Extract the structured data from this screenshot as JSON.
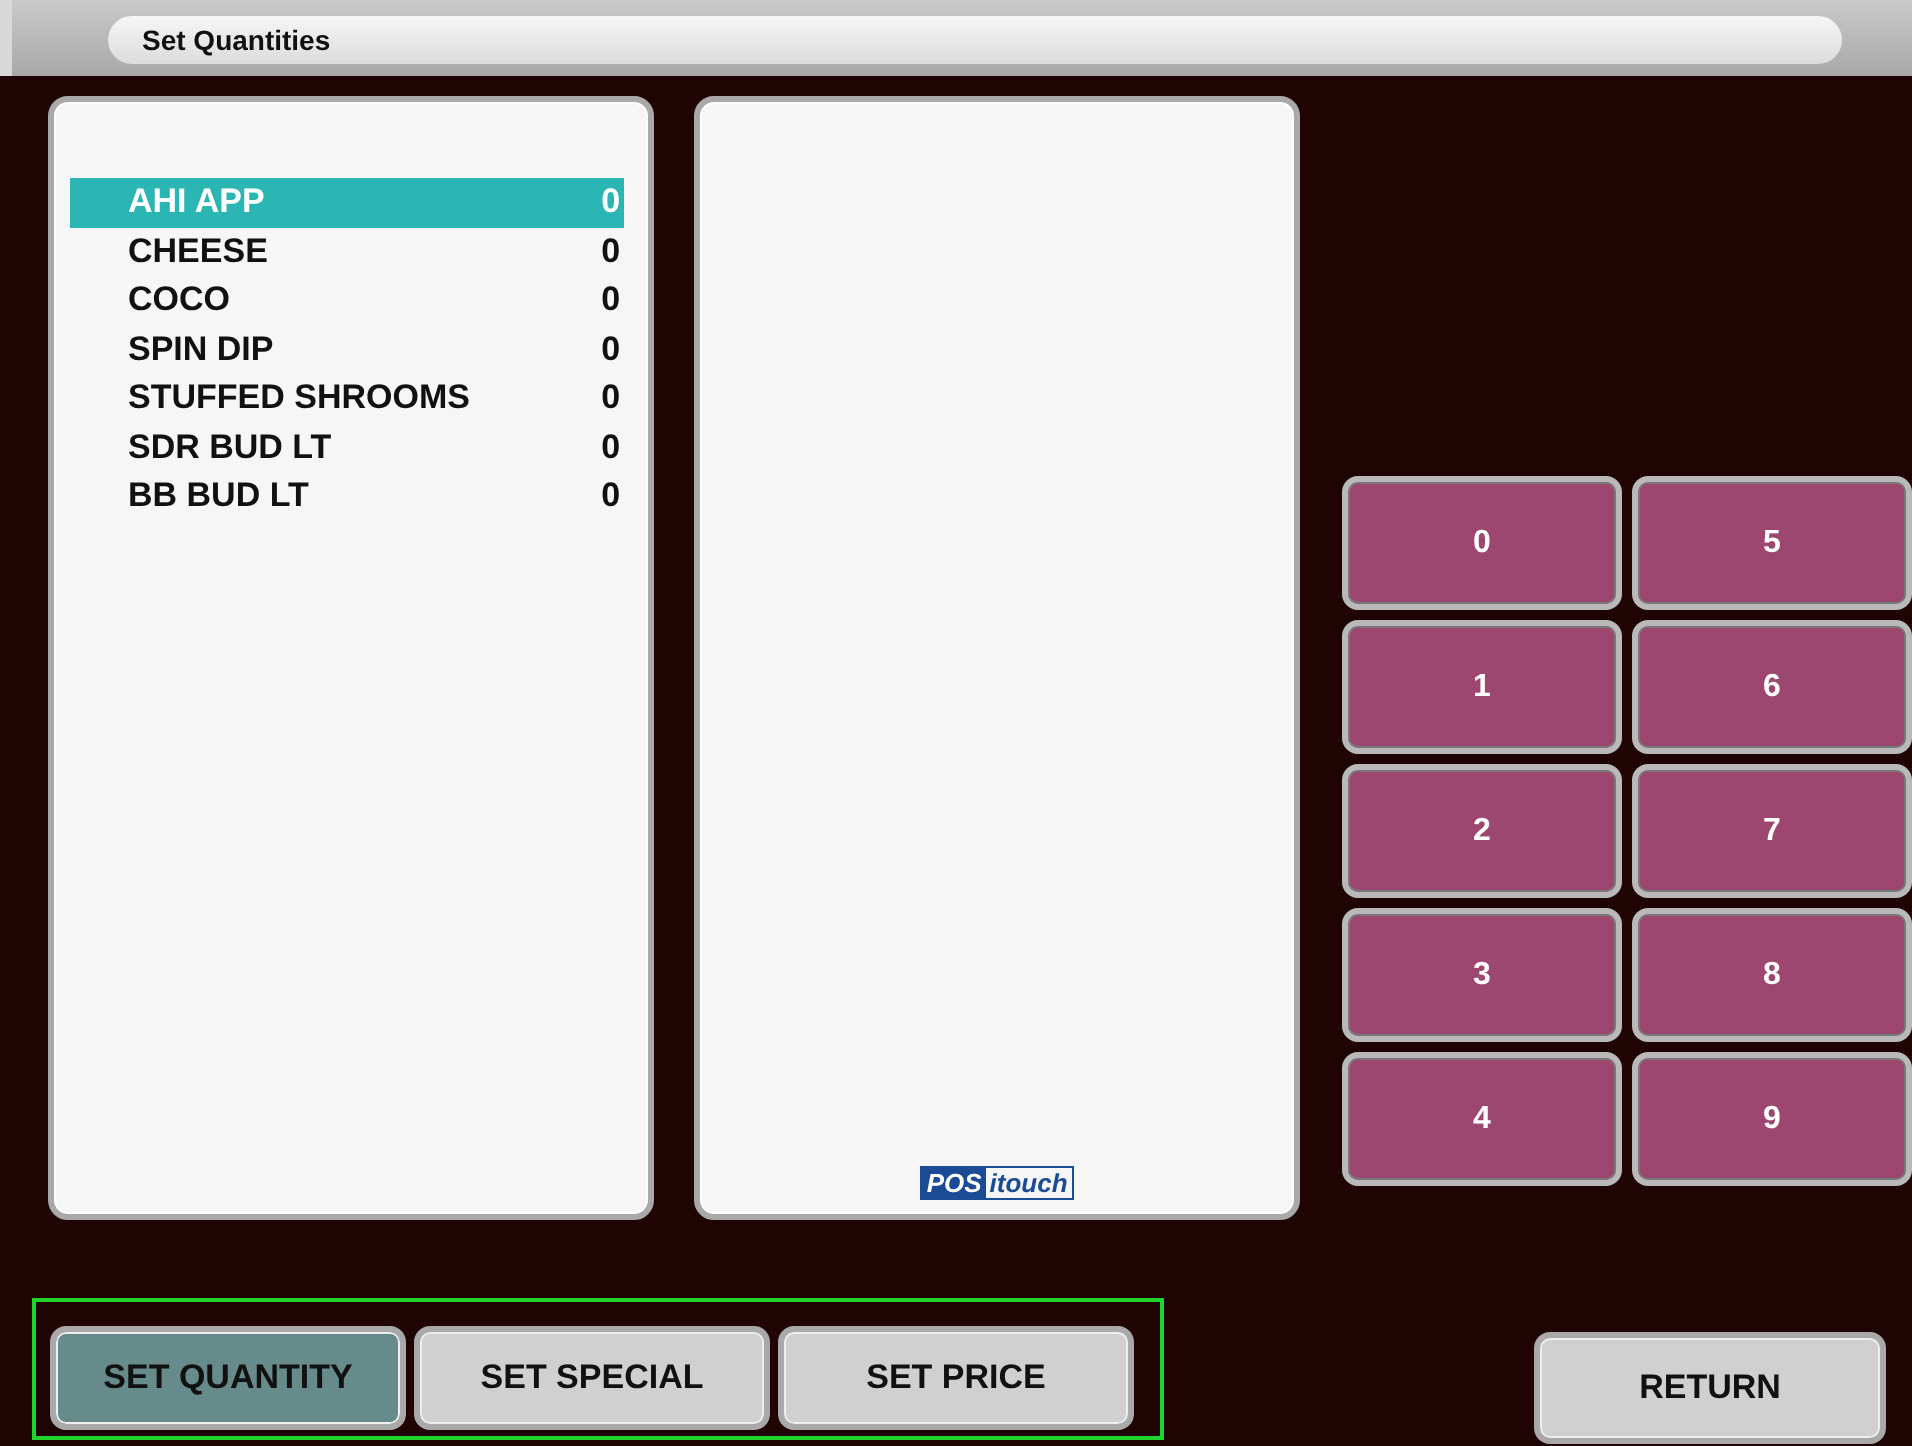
{
  "window": {
    "title": "Set Quantities"
  },
  "items": [
    {
      "name": "AHI APP",
      "quantity": "0",
      "selected": true
    },
    {
      "name": "CHEESE",
      "quantity": "0",
      "selected": false
    },
    {
      "name": "COCO",
      "quantity": "0",
      "selected": false
    },
    {
      "name": "SPIN DIP",
      "quantity": "0",
      "selected": false
    },
    {
      "name": "STUFFED SHROOMS",
      "quantity": "0",
      "selected": false
    },
    {
      "name": "SDR BUD LT",
      "quantity": "0",
      "selected": false
    },
    {
      "name": "BB BUD LT",
      "quantity": "0",
      "selected": false
    }
  ],
  "logo": {
    "boxed": "POS",
    "rest": "itouch"
  },
  "keypad": [
    "0",
    "1",
    "2",
    "3",
    "4",
    "5",
    "6",
    "7",
    "8",
    "9"
  ],
  "modes": [
    {
      "label": "SET QUANTITY",
      "selected": true
    },
    {
      "label": "SET SPECIAL",
      "selected": false
    },
    {
      "label": "SET PRICE",
      "selected": false
    }
  ],
  "return_button": "RETURN"
}
